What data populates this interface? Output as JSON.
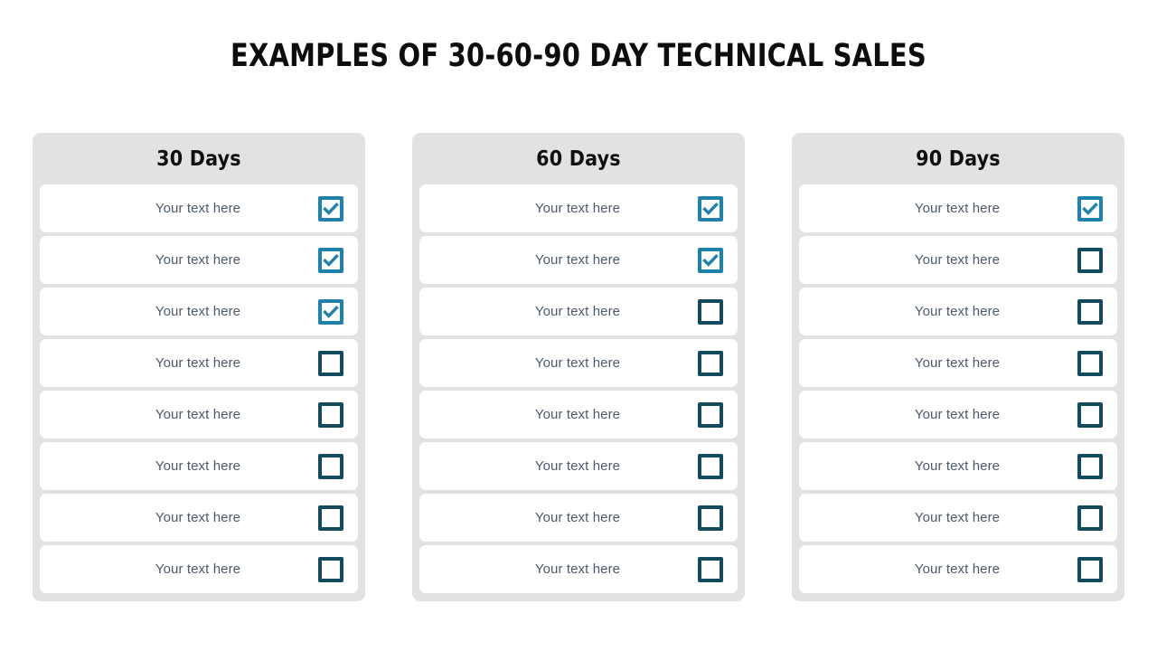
{
  "slide": {
    "title": "EXAMPLES OF 30-60-90 DAY TECHNICAL SALES",
    "background_color": "#ffffff"
  },
  "theme": {
    "card_background": "#e2e2e2",
    "row_background": "#ffffff",
    "row_text_color": "#4d5a6b",
    "checked_checkbox_color": "#1f81ad",
    "unchecked_checkbox_color": "#124a5e",
    "title_color": "#0d0d0d"
  },
  "columns": [
    {
      "id": "col-30-days",
      "header": "30 Days",
      "rows": [
        {
          "label": "Your text here",
          "checked": true,
          "icon": "checkbox-checked-icon"
        },
        {
          "label": "Your text here",
          "checked": true,
          "icon": "checkbox-checked-icon"
        },
        {
          "label": "Your text here",
          "checked": true,
          "icon": "checkbox-checked-icon"
        },
        {
          "label": "Your text here",
          "checked": false,
          "icon": "checkbox-unchecked-icon"
        },
        {
          "label": "Your text here",
          "checked": false,
          "icon": "checkbox-unchecked-icon"
        },
        {
          "label": "Your text here",
          "checked": false,
          "icon": "checkbox-unchecked-icon"
        },
        {
          "label": "Your text here",
          "checked": false,
          "icon": "checkbox-unchecked-icon"
        },
        {
          "label": "Your text here",
          "checked": false,
          "icon": "checkbox-unchecked-icon"
        }
      ]
    },
    {
      "id": "col-60-days",
      "header": "60 Days",
      "rows": [
        {
          "label": "Your text here",
          "checked": true,
          "icon": "checkbox-checked-icon"
        },
        {
          "label": "Your text here",
          "checked": true,
          "icon": "checkbox-checked-icon"
        },
        {
          "label": "Your text here",
          "checked": false,
          "icon": "checkbox-unchecked-icon"
        },
        {
          "label": "Your text here",
          "checked": false,
          "icon": "checkbox-unchecked-icon"
        },
        {
          "label": "Your text here",
          "checked": false,
          "icon": "checkbox-unchecked-icon"
        },
        {
          "label": "Your text here",
          "checked": false,
          "icon": "checkbox-unchecked-icon"
        },
        {
          "label": "Your text here",
          "checked": false,
          "icon": "checkbox-unchecked-icon"
        },
        {
          "label": "Your text here",
          "checked": false,
          "icon": "checkbox-unchecked-icon"
        }
      ]
    },
    {
      "id": "col-90-days",
      "header": "90 Days",
      "rows": [
        {
          "label": "Your text here",
          "checked": true,
          "icon": "checkbox-checked-icon"
        },
        {
          "label": "Your text here",
          "checked": false,
          "icon": "checkbox-unchecked-icon"
        },
        {
          "label": "Your text here",
          "checked": false,
          "icon": "checkbox-unchecked-icon"
        },
        {
          "label": "Your text here",
          "checked": false,
          "icon": "checkbox-unchecked-icon"
        },
        {
          "label": "Your text here",
          "checked": false,
          "icon": "checkbox-unchecked-icon"
        },
        {
          "label": "Your text here",
          "checked": false,
          "icon": "checkbox-unchecked-icon"
        },
        {
          "label": "Your text here",
          "checked": false,
          "icon": "checkbox-unchecked-icon"
        },
        {
          "label": "Your text here",
          "checked": false,
          "icon": "checkbox-unchecked-icon"
        }
      ]
    }
  ]
}
